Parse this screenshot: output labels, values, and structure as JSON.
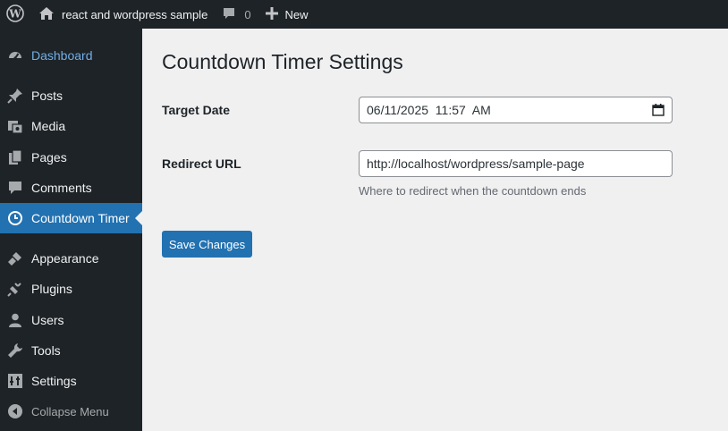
{
  "adminbar": {
    "site_name": "react and wordpress sample",
    "comments_count": "0",
    "new_label": "New"
  },
  "sidebar": {
    "items": [
      {
        "label": "Dashboard",
        "icon": "dashboard-icon"
      },
      {
        "label": "Posts",
        "icon": "pin-icon"
      },
      {
        "label": "Media",
        "icon": "media-icon"
      },
      {
        "label": "Pages",
        "icon": "pages-icon"
      },
      {
        "label": "Comments",
        "icon": "comment-icon"
      },
      {
        "label": "Countdown Timer",
        "icon": "clock-icon"
      },
      {
        "label": "Appearance",
        "icon": "brush-icon"
      },
      {
        "label": "Plugins",
        "icon": "plug-icon"
      },
      {
        "label": "Users",
        "icon": "user-icon"
      },
      {
        "label": "Tools",
        "icon": "wrench-icon"
      },
      {
        "label": "Settings",
        "icon": "sliders-icon"
      }
    ],
    "collapse_label": "Collapse Menu"
  },
  "main": {
    "title": "Countdown Timer Settings",
    "fields": {
      "target_date": {
        "label": "Target Date",
        "value": "06/11/2025  11:57  AM"
      },
      "redirect_url": {
        "label": "Redirect URL",
        "value": "http://localhost/wordpress/sample-page",
        "description": "Where to redirect when the countdown ends"
      }
    },
    "save_button": "Save Changes"
  },
  "colors": {
    "adminbar_bg": "#1d2327",
    "accent": "#2271b1",
    "link_highlight": "#72aee6",
    "page_bg": "#f0f0f1"
  }
}
